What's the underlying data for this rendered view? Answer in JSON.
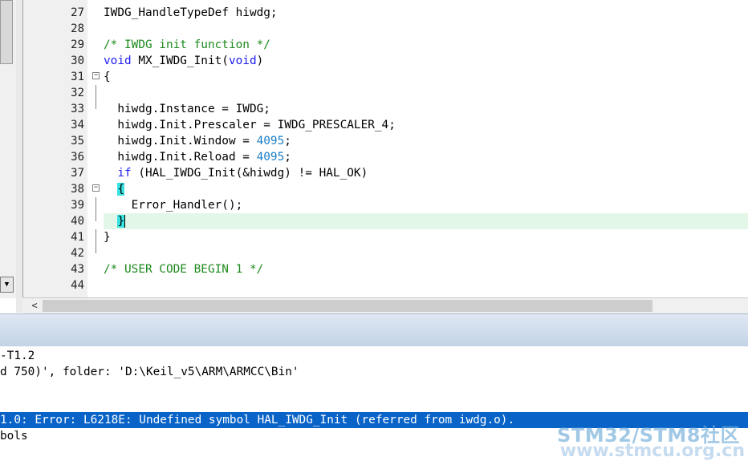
{
  "editor": {
    "lines": [
      {
        "n": "27",
        "parts": [
          {
            "t": "IWDG_HandleTypeDef hiwdg;",
            "c": ""
          }
        ]
      },
      {
        "n": "28",
        "parts": []
      },
      {
        "n": "29",
        "parts": [
          {
            "t": "/* IWDG init function */",
            "c": "cm"
          }
        ]
      },
      {
        "n": "30",
        "parts": [
          {
            "t": "void",
            "c": "kw"
          },
          {
            "t": " MX_IWDG_Init(",
            "c": ""
          },
          {
            "t": "void",
            "c": "kw"
          },
          {
            "t": ")",
            "c": ""
          }
        ]
      },
      {
        "n": "31",
        "fold": "−",
        "parts": [
          {
            "t": "{",
            "c": ""
          }
        ]
      },
      {
        "n": "32",
        "parts": []
      },
      {
        "n": "33",
        "parts": [
          {
            "t": "  hiwdg.Instance = IWDG;",
            "c": ""
          }
        ]
      },
      {
        "n": "34",
        "parts": [
          {
            "t": "  hiwdg.Init.Prescaler = IWDG_PRESCALER_4;",
            "c": ""
          }
        ]
      },
      {
        "n": "35",
        "parts": [
          {
            "t": "  hiwdg.Init.Window = ",
            "c": ""
          },
          {
            "t": "4095",
            "c": "num"
          },
          {
            "t": ";",
            "c": ""
          }
        ]
      },
      {
        "n": "36",
        "parts": [
          {
            "t": "  hiwdg.Init.Reload = ",
            "c": ""
          },
          {
            "t": "4095",
            "c": "num"
          },
          {
            "t": ";",
            "c": ""
          }
        ]
      },
      {
        "n": "37",
        "parts": [
          {
            "t": "  ",
            "c": ""
          },
          {
            "t": "if",
            "c": "kw"
          },
          {
            "t": " (HAL_IWDG_Init(&hiwdg) != HAL_OK)",
            "c": ""
          }
        ]
      },
      {
        "n": "38",
        "fold": "−",
        "parts": [
          {
            "t": "  ",
            "c": ""
          },
          {
            "t": "{",
            "c": "brace"
          }
        ]
      },
      {
        "n": "39",
        "parts": [
          {
            "t": "    Error_Handler();",
            "c": ""
          }
        ]
      },
      {
        "n": "40",
        "current": true,
        "parts": [
          {
            "t": "  ",
            "c": ""
          },
          {
            "t": "}",
            "c": "brace"
          }
        ]
      },
      {
        "n": "41",
        "parts": [
          {
            "t": "}",
            "c": ""
          }
        ]
      },
      {
        "n": "42",
        "parts": []
      },
      {
        "n": "43",
        "parts": [
          {
            "t": "/* USER CODE BEGIN 1 */",
            "c": "cm"
          }
        ]
      },
      {
        "n": "44",
        "parts": []
      }
    ]
  },
  "output": {
    "lines": [
      {
        "text": "-T1.2",
        "error": false
      },
      {
        "text": "d 750)', folder: 'D:\\Keil_v5\\ARM\\ARMCC\\Bin'",
        "error": false
      },
      {
        "text": "",
        "error": false
      },
      {
        "text": "",
        "error": false
      },
      {
        "text": "1.0: Error: L6218E: Undefined symbol HAL_IWDG_Init (referred from iwdg.o).",
        "error": true
      },
      {
        "text": "bols",
        "error": false
      }
    ]
  },
  "watermark": {
    "line1": "STM32/STM8社区",
    "line2": "www.stmcu.org.cn"
  },
  "colors": {
    "keyword": "#1c1cf0",
    "comment": "#1e8a1e",
    "number": "#1c7ec8",
    "brace_match": "#39e1e1",
    "current_line": "#e3f7e8",
    "error_highlight": "#0a64c8"
  }
}
